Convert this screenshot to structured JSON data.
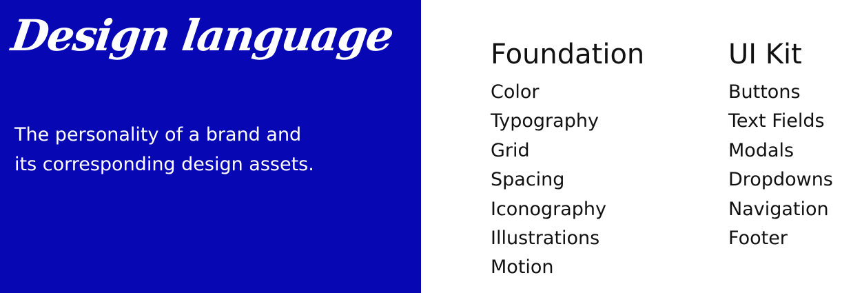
{
  "hero": {
    "title": "Design language",
    "description": "The personality of a brand and its corresponding design assets."
  },
  "foundation": {
    "heading": "Foundation",
    "items": [
      "Color",
      "Typography",
      "Grid",
      "Spacing",
      "Iconography",
      "Illustrations",
      "Motion"
    ]
  },
  "ui_kit": {
    "heading": "UI Kit",
    "items": [
      "Buttons",
      "Text Fields",
      "Modals",
      "Dropdowns",
      "Navigation",
      "Footer"
    ]
  },
  "colors": {
    "hero_background": "#0707b3",
    "hero_text": "#ffffff",
    "menu_text": "#111111",
    "page_background": "#ffffff"
  }
}
